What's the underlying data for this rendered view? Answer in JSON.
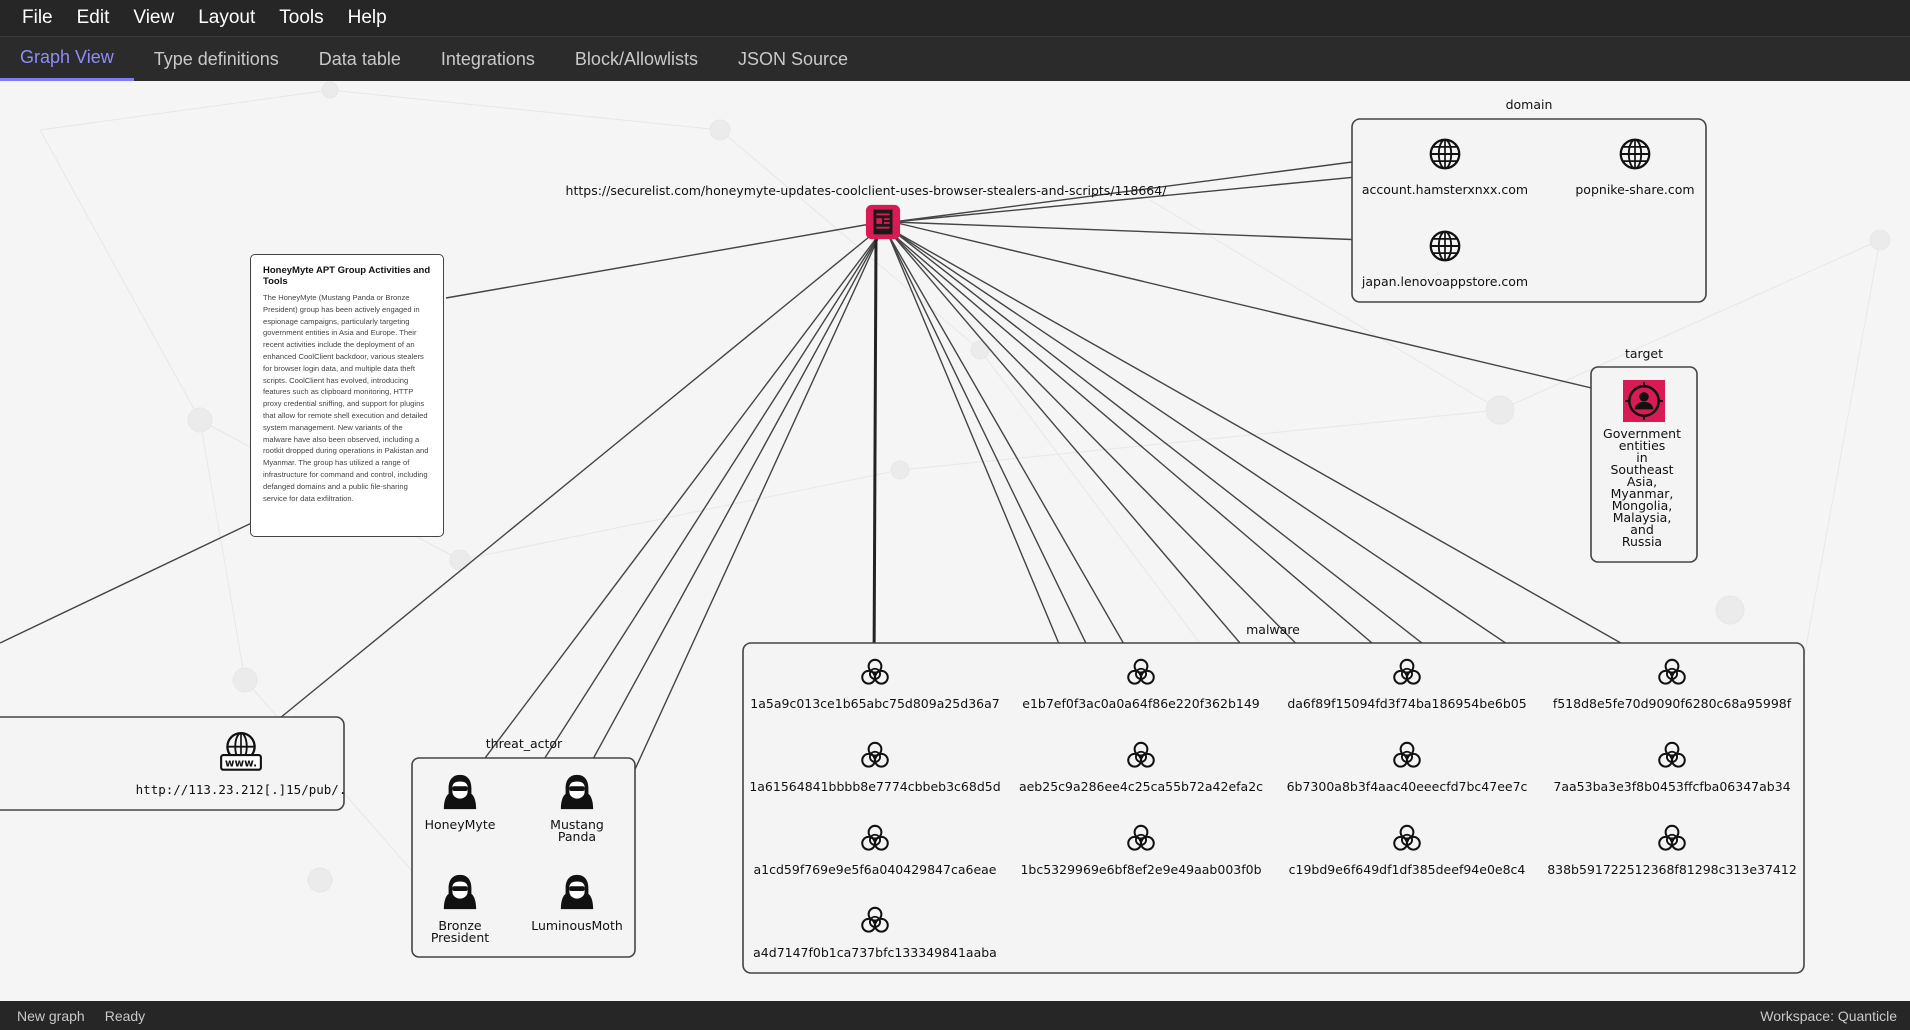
{
  "menu": {
    "items": [
      "File",
      "Edit",
      "View",
      "Layout",
      "Tools",
      "Help"
    ]
  },
  "tabs": {
    "items": [
      "Graph View",
      "Type definitions",
      "Data table",
      "Integrations",
      "Block/Allowlists",
      "JSON Source"
    ],
    "active": "Graph View"
  },
  "colors": {
    "accent": "#7f7cf0",
    "report_node": "#d81b55",
    "target_node": "#d81b55",
    "menubar": "#262626"
  },
  "graph": {
    "report": {
      "url": "https://securelist.com/honeymyte-updates-coolclient-uses-browser-stealers-and-scripts/118664/",
      "icon": "report-icon"
    },
    "note": {
      "title": "HoneyMyte APT Group Activities and Tools",
      "body": "The HoneyMyte (Mustang Panda or Bronze President) group has been actively engaged in espionage campaigns, particularly targeting government entities in Asia and Europe. Their recent activities include the deployment of an enhanced CoolClient backdoor, various stealers for browser login data, and multiple data theft scripts. CoolClient has evolved, introducing features such as clipboard monitoring, HTTP proxy credential sniffing, and support for plugins that allow for remote shell execution and detailed system management. New variants of the malware have also been observed, including a rootkit dropped during operations in Pakistan and Myanmar. The group has utilized a range of infrastructure for command and control, including defanged domains and a public file-sharing service for data exfiltration."
    },
    "domain_group": {
      "label": "domain",
      "nodes": [
        "account.hamsterxnxx.com",
        "popnike-share.com",
        "japan.lenovoappstore.com"
      ],
      "icon": "globe-icon"
    },
    "target_group": {
      "label": "target",
      "node": [
        "Government",
        "entities",
        "in",
        "Southeast",
        "Asia,",
        "Myanmar,",
        "Mongolia,",
        "Malaysia,",
        "and",
        "Russia"
      ],
      "icon": "target-person-icon"
    },
    "url_node": {
      "label": "http://113.23.212[.]15/pub/.",
      "icon": "www-globe-icon"
    },
    "threat_actor_group": {
      "label": "threat_actor",
      "nodes": [
        {
          "lines": [
            "HoneyMyte"
          ]
        },
        {
          "lines": [
            "Mustang",
            "Panda"
          ]
        },
        {
          "lines": [
            "Bronze",
            "President"
          ]
        },
        {
          "lines": [
            "LuminousMoth"
          ]
        }
      ],
      "icon": "hacker-icon"
    },
    "malware_group": {
      "label": "malware",
      "icon": "biohazard-icon",
      "nodes": [
        "1a5a9c013ce1b65abc75d809a25d36a7",
        "1a61564841bbbb8e7774cbbeb3c68d5d",
        "a1cd59f769e9e5f6a040429847ca6eae",
        "a4d7147f0b1ca737bfc133349841aaba",
        "e1b7ef0f3ac0a0a64f86e220f362b149",
        "aeb25c9a286ee4c25ca55b72a42efa2c",
        "1bc5329969e6bf8ef2e9e49aab003f0b",
        "da6f89f15094fd3f74ba186954be6b05",
        "6b7300a8b3f4aac40eeecfd7bc47ee7c",
        "c19bd9e6f649df1df385deef94e0e8c4",
        "f518d8e5fe70d9090f6280c68a95998f",
        "7aa53ba3e3f8b0453ffcfba06347ab34",
        "838b591722512368f81298c313e37412"
      ]
    }
  },
  "status": {
    "new_graph": "New graph",
    "state": "Ready",
    "workspace": "Workspace: Quanticle"
  }
}
